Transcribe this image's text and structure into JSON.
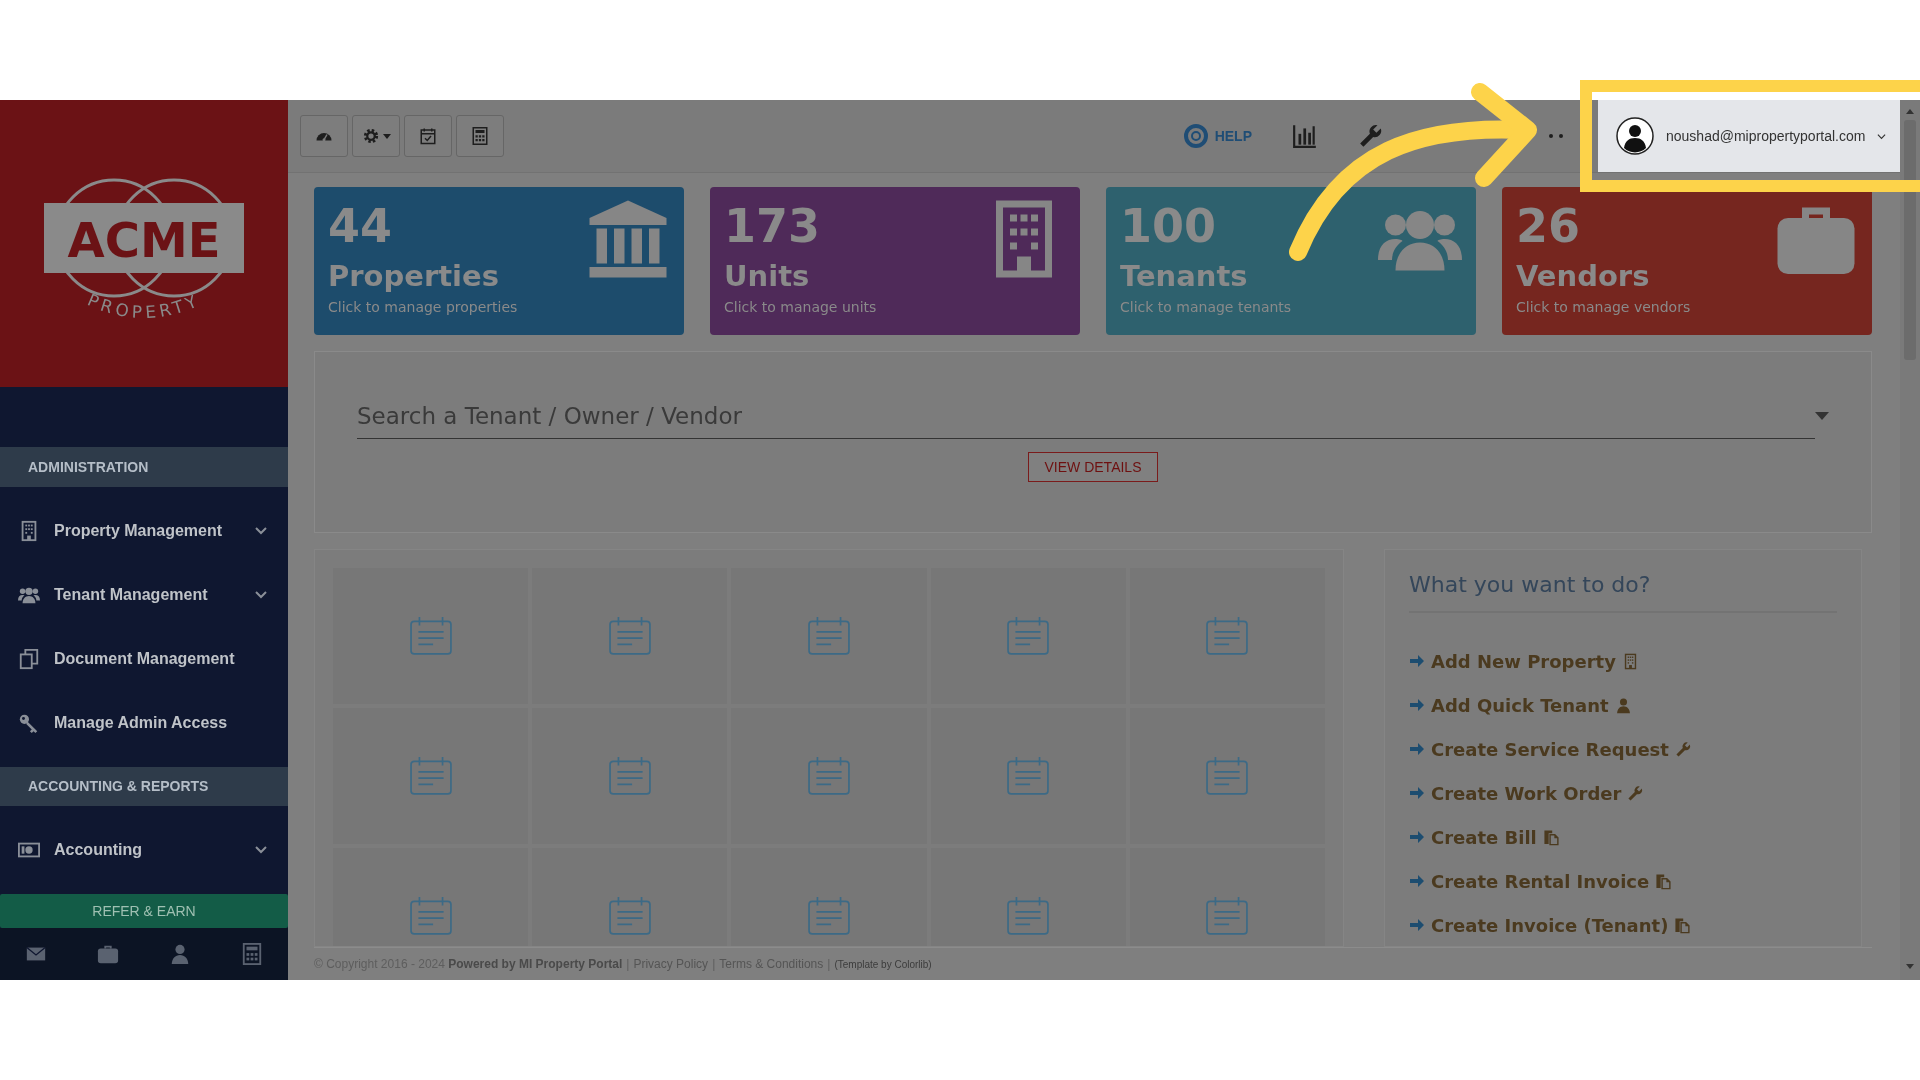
{
  "logo": {
    "name": "ACME",
    "tagline": "PROPERTY"
  },
  "sidebar": {
    "sections": [
      {
        "title": "ADMINISTRATION",
        "items": [
          {
            "kind": "building",
            "label": "Property Management",
            "submenu": true
          },
          {
            "kind": "users",
            "label": "Tenant Management",
            "submenu": true
          },
          {
            "kind": "documents",
            "label": "Document Management",
            "submenu": false
          },
          {
            "kind": "key",
            "label": "Manage Admin Access",
            "submenu": false
          }
        ]
      },
      {
        "title": "ACCOUNTING & REPORTS",
        "items": [
          {
            "kind": "money",
            "label": "Accounting",
            "submenu": true
          }
        ]
      }
    ],
    "refer_button": "REFER & EARN"
  },
  "toolbar": {
    "help": "HELP",
    "user_email": "noushad@mipropertyportal.com"
  },
  "cards": [
    {
      "count": "44",
      "title": "Properties",
      "subtitle": "Click to manage properties",
      "color": "#1d4c6c",
      "kind": "bank"
    },
    {
      "count": "173",
      "title": "Units",
      "subtitle": "Click to manage units",
      "color": "#4f2a59",
      "kind": "building"
    },
    {
      "count": "100",
      "title": "Tenants",
      "subtitle": "Click to manage tenants",
      "color": "#2e616e",
      "kind": "users"
    },
    {
      "count": "26",
      "title": "Vendors",
      "subtitle": "Click to manage vendors",
      "color": "#76261f",
      "kind": "briefcase"
    }
  ],
  "search": {
    "placeholder": "Search a Tenant / Owner / Vendor",
    "button": "VIEW DETAILS"
  },
  "quick_actions": {
    "title": "What you want to do?",
    "items": [
      {
        "label": "Add New Property",
        "kind": "building"
      },
      {
        "label": "Add Quick Tenant",
        "kind": "user"
      },
      {
        "label": "Create Service Request",
        "kind": "wrench"
      },
      {
        "label": "Create Work Order",
        "kind": "wrench"
      },
      {
        "label": "Create Bill",
        "kind": "copy"
      },
      {
        "label": "Create Rental Invoice",
        "kind": "copy"
      },
      {
        "label": "Create Invoice (Tenant)",
        "kind": "copy"
      }
    ]
  },
  "footer": [
    {
      "kind": "text",
      "text": "© Copyright 2016 - 2024 **Powered by MI Property Portal**"
    },
    {
      "kind": "sep",
      "text": "|"
    },
    {
      "kind": "link",
      "text": "Privacy Policy"
    },
    {
      "kind": "sep",
      "text": "|"
    },
    {
      "kind": "link",
      "text": "Terms & Conditions"
    },
    {
      "kind": "sep",
      "text": "|"
    },
    {
      "kind": "small",
      "text": "(Template by Colorlib)"
    }
  ]
}
